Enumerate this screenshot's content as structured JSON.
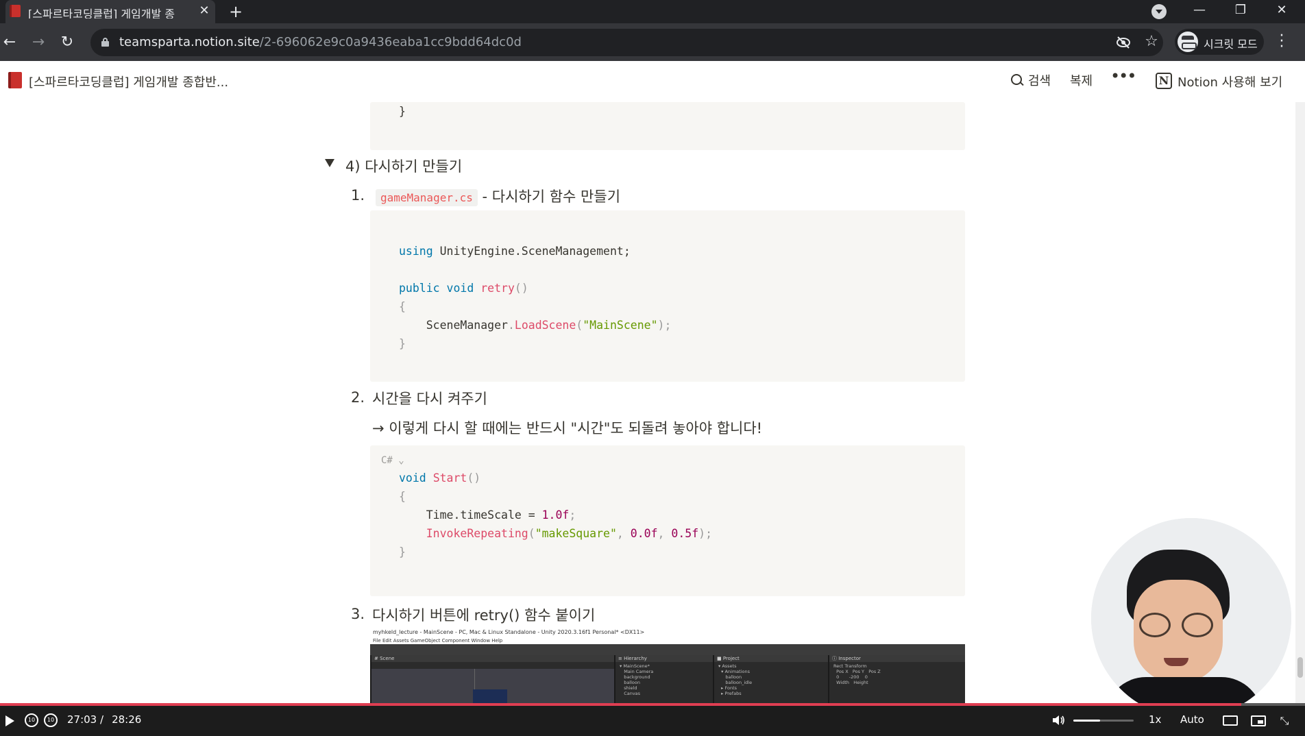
{
  "browser": {
    "tab_title": "[스파르타코딩클럽] 게임개발 종",
    "tab_close": "✕",
    "new_tab": "+",
    "window_controls": {
      "minimize": "—",
      "restore": "❐",
      "close": "✕"
    },
    "url_host": "teamsparta.notion.site",
    "url_path": "/2-696062e9c0a9436eaba1cc9bdd64dc0d",
    "incognito_label": "시크릿 모드",
    "icons": [
      "back-icon",
      "forward-icon",
      "reload-icon",
      "lock-icon",
      "eye-off-icon",
      "star-icon",
      "incognito-icon",
      "kebab-icon"
    ]
  },
  "notion": {
    "page_title": "[스파르타코딩클럽] 게임개발 종합반...",
    "search_label": "검색",
    "duplicate_label": "복제",
    "more_label": "•••",
    "notion_logo": "N",
    "try_label": "Notion 사용해 보기"
  },
  "content": {
    "prev_code_tail": "}",
    "toggle_title": "4) 다시하기 만들기",
    "item1": {
      "num": "1.",
      "code": "gameManager.cs",
      "text": " - 다시하기 함수 만들기",
      "code_lines": {
        "l1_kw": "using",
        "l1_rest": " UnityEngine.SceneManagement;",
        "l2_kw1": "public",
        "l2_kw2": "void",
        "l2_fn": "retry",
        "l2_paren": "()",
        "l3": "{",
        "l4_obj": "    SceneManager",
        "l4_dot": ".",
        "l4_fn": "LoadScene",
        "l4_open": "(",
        "l4_str": "\"MainScene\"",
        "l4_close": ");",
        "l5": "}"
      }
    },
    "item2": {
      "num": "2.",
      "text": "시간을 다시 켜주기",
      "note": "→ 이렇게 다시 할 때에는 반드시 \"시간\"도 되돌려 놓아야 합니다!",
      "lang": "C# ⌄",
      "code_lines": {
        "l1_kw": "void",
        "l1_fn": "Start",
        "l1_paren": "()",
        "l2": "{",
        "l3_obj": "    Time.timeScale",
        "l3_op": " = ",
        "l3_num": "1.0f",
        "l3_end": ";",
        "l4_fn": "    InvokeRepeating",
        "l4_open": "(",
        "l4_str": "\"makeSquare\"",
        "l4_comma": ", ",
        "l4_n1": "0.0f",
        "l4_comma2": ", ",
        "l4_n2": "0.5f",
        "l4_close": ");",
        "l5": "}"
      }
    },
    "item3": {
      "num": "3.",
      "text": "다시하기 버튼에 retry() 함수 붙이기"
    },
    "unity": {
      "titlebar": "myhkeld_lecture - MainScene - PC, Mac & Linux Standalone - Unity 2020.3.16f1 Personal* <DX11>",
      "menubar": "File   Edit   Assets   GameObject   Component   Window   Help",
      "scene_tab": "# Scene",
      "hierarchy_tab": "≡ Hierarchy",
      "project_tab": "■ Project",
      "inspector_tab": "ⓘ Inspector",
      "hierarchy_tree": "▾ MainScene*\n   Main Camera\n   background\n   balloon\n   shield\n   Canvas",
      "project_tree": "▾ Assets\n  ▾ Animations\n     balloon\n     balloon_idle\n  ▸ Fonts\n  ▸ Prefabs",
      "inspector_tree": "Rect Transform\n  Pos X   Pos Y   Pos Z\n  0       -200    0\n  Width   Height"
    }
  },
  "player": {
    "current_time": "27:03 /",
    "total_time": "28:26",
    "progress_percent": 95.1,
    "volume_percent": 44,
    "speed": "1x",
    "quality": "Auto",
    "skip_back": "10",
    "skip_fwd": "10"
  },
  "colors": {
    "progress": "#e03e52",
    "code_keyword": "#0077aa",
    "code_function": "#dd4a68",
    "code_string": "#669900",
    "inline_code": "#eb5757"
  }
}
